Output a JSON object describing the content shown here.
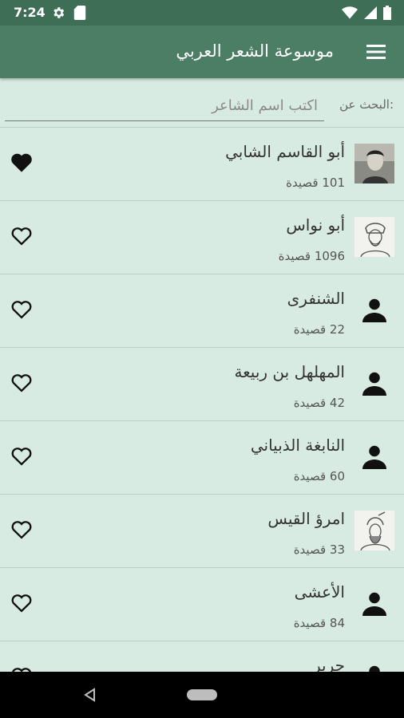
{
  "status": {
    "time": "7:24"
  },
  "app": {
    "title": "موسوعة الشعر العربي"
  },
  "search": {
    "label": "البحث عن:",
    "placeholder": "اكتب اسم الشاعر"
  },
  "poets": [
    {
      "name": "أبو القاسم الشابي",
      "count": "101 قصيدة",
      "favorite": true,
      "avatar": "photo"
    },
    {
      "name": "أبو نواس",
      "count": "1096 قصيدة",
      "favorite": false,
      "avatar": "sketch"
    },
    {
      "name": "الشنفرى",
      "count": "22 قصيدة",
      "favorite": false,
      "avatar": "person"
    },
    {
      "name": "المهلهل بن ربيعة",
      "count": "42 قصيدة",
      "favorite": false,
      "avatar": "person"
    },
    {
      "name": "النابغة الذبياني",
      "count": "60 قصيدة",
      "favorite": false,
      "avatar": "person"
    },
    {
      "name": "امرؤ القيس",
      "count": "33 قصيدة",
      "favorite": false,
      "avatar": "sketch"
    },
    {
      "name": "الأعشى",
      "count": "84 قصيدة",
      "favorite": false,
      "avatar": "person"
    },
    {
      "name": "جرير",
      "count": "",
      "favorite": false,
      "avatar": "person"
    }
  ],
  "colors": {
    "statusbar": "#3f6e57",
    "appbar": "#4b7e65",
    "background": "#d8ebe2"
  },
  "icons": [
    "settings-icon",
    "sd-card-icon",
    "wifi-icon",
    "signal-icon",
    "battery-icon",
    "menu-icon",
    "heart-icon",
    "person-icon",
    "back-icon",
    "home-icon"
  ]
}
